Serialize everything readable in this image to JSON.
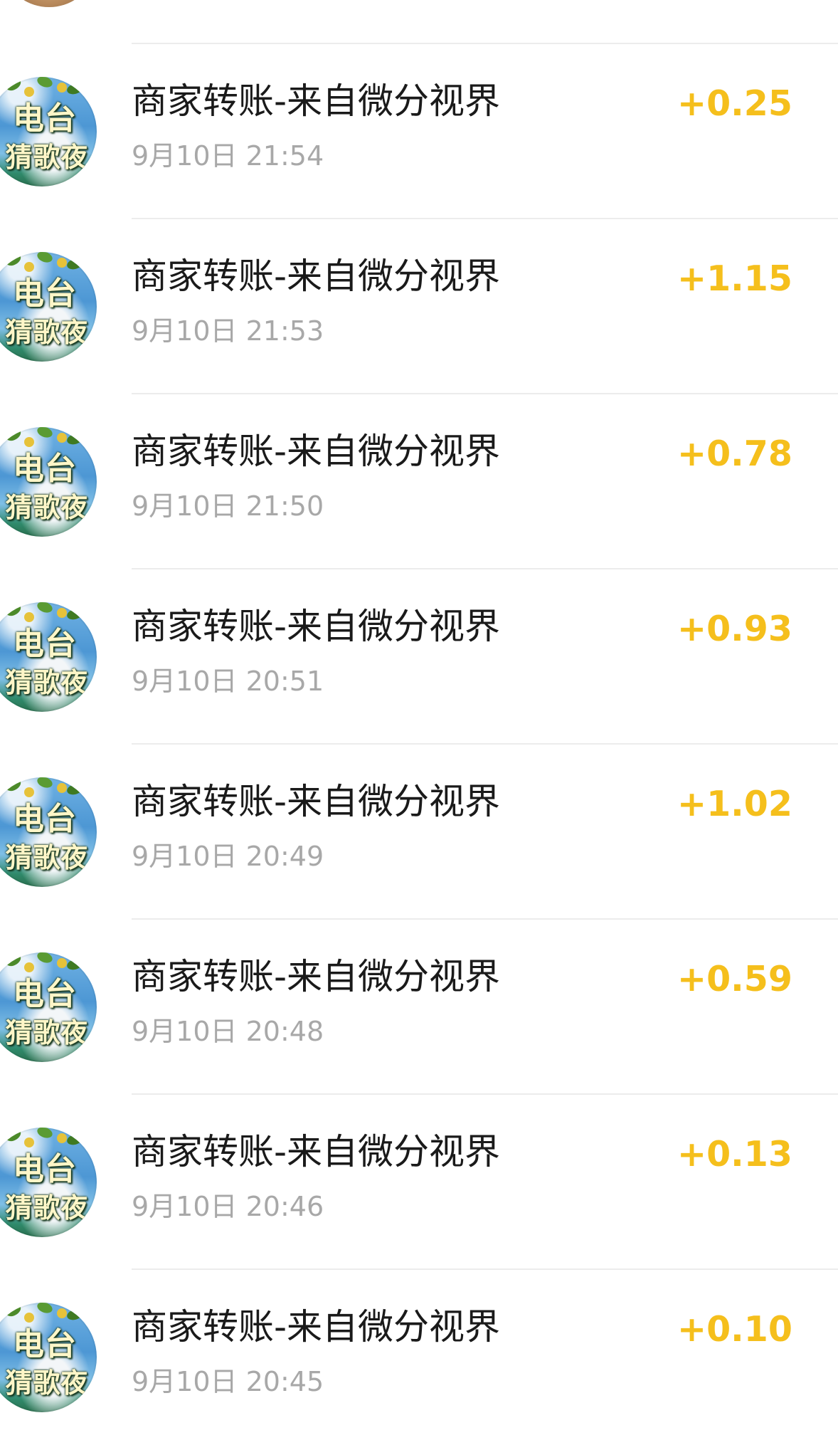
{
  "transactions": [
    {
      "title": "商家转账-来自微分视界",
      "time": "9月10日 21:54",
      "amount": "+0.25"
    },
    {
      "title": "商家转账-来自微分视界",
      "time": "9月10日 21:53",
      "amount": "+1.15"
    },
    {
      "title": "商家转账-来自微分视界",
      "time": "9月10日 21:50",
      "amount": "+0.78"
    },
    {
      "title": "商家转账-来自微分视界",
      "time": "9月10日 20:51",
      "amount": "+0.93"
    },
    {
      "title": "商家转账-来自微分视界",
      "time": "9月10日 20:49",
      "amount": "+1.02"
    },
    {
      "title": "商家转账-来自微分视界",
      "time": "9月10日 20:48",
      "amount": "+0.59"
    },
    {
      "title": "商家转账-来自微分视界",
      "time": "9月10日 20:46",
      "amount": "+0.13"
    },
    {
      "title": "商家转账-来自微分视界",
      "time": "9月10日 20:45",
      "amount": "+0.10"
    }
  ],
  "avatar": {
    "line1": "电台",
    "line2": "猜歌夜"
  },
  "colors": {
    "amount": "#f5bf1c",
    "title": "#1a1a1a",
    "time": "#a8a8a8",
    "divider": "#ececec"
  }
}
